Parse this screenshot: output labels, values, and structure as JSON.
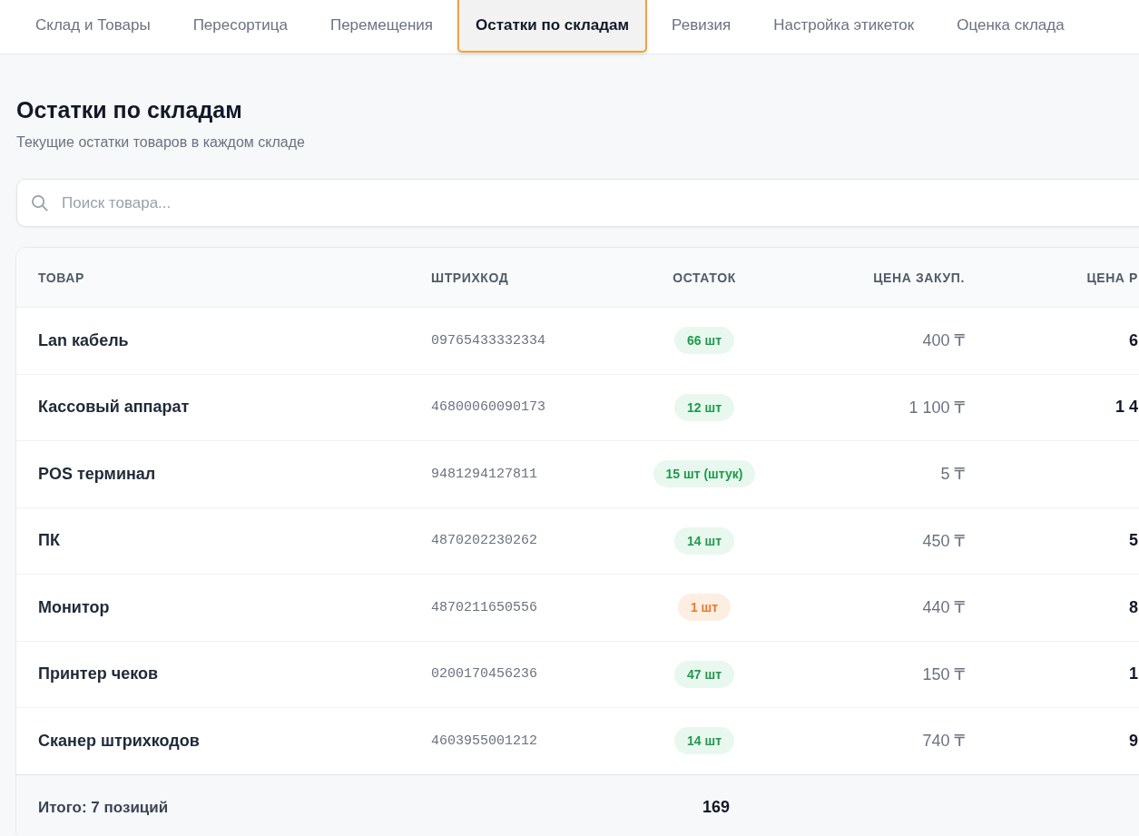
{
  "tabs": [
    {
      "label": "Склад и Товары",
      "selected": false
    },
    {
      "label": "Пересортица",
      "selected": false
    },
    {
      "label": "Перемещения",
      "selected": false
    },
    {
      "label": "Остатки по складам",
      "selected": true
    },
    {
      "label": "Ревизия",
      "selected": false
    },
    {
      "label": "Настройка этикеток",
      "selected": false
    },
    {
      "label": "Оценка склада",
      "selected": false
    }
  ],
  "page": {
    "title": "Остатки по складам",
    "subtitle": "Текущие остатки товаров в каждом складе"
  },
  "search": {
    "placeholder": "Поиск товара..."
  },
  "table": {
    "columns": [
      "ТОВАР",
      "ШТРИХКОД",
      "ОСТАТОК",
      "ЦЕНА ЗАКУП.",
      "ЦЕНА Р"
    ],
    "rows": [
      {
        "product": "Lan кабель",
        "barcode": "09765433332334",
        "stock": "66 шт",
        "low_stock": false,
        "purchase_price": "400 ₸",
        "column_5": "6"
      },
      {
        "product": "Кассовый аппарат",
        "barcode": "46800060090173",
        "stock": "12 шт",
        "low_stock": false,
        "purchase_price": "1 100 ₸",
        "column_5": "1 4"
      },
      {
        "product": "POS терминал",
        "barcode": "9481294127811",
        "stock": "15 шт (штук)",
        "low_stock": false,
        "purchase_price": "5 ₸"
      },
      {
        "product": "ПК",
        "barcode": "4870202230262",
        "stock": "14 шт",
        "low_stock": false,
        "purchase_price": "450 ₸",
        "column_5": "5"
      },
      {
        "product": "Монитор",
        "barcode": "4870211650556",
        "stock": "1 шт",
        "low_stock": true,
        "purchase_price": "440 ₸",
        "column_5": "8"
      },
      {
        "product": "Принтер чеков",
        "barcode": "0200170456236",
        "stock": "47 шт",
        "low_stock": false,
        "purchase_price": "150 ₸",
        "column_5": "1"
      },
      {
        "product": "Сканер штрихкодов",
        "barcode": "4603955001212",
        "stock": "14 шт",
        "low_stock": false,
        "purchase_price": "740 ₸",
        "column_5": "9"
      }
    ],
    "footer": {
      "label": "Итого: 7 позиций",
      "total_stock": "169"
    }
  }
}
